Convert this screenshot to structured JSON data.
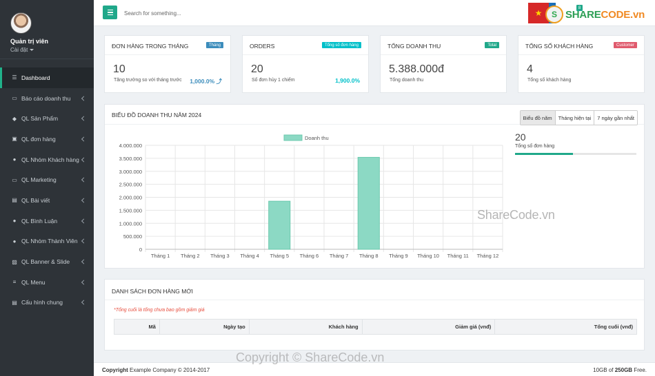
{
  "colors": {
    "sidebar_bg": "#2e3338",
    "accent": "#20a88a",
    "bar_fill": "#8cd9c4",
    "badge_blue": "#3c8dbc",
    "badge_teal": "#00c0c9",
    "badge_green": "#20a88a",
    "badge_red": "#e05a6d",
    "note_red": "#e74c3c"
  },
  "profile": {
    "name": "Quản trị viên",
    "sub": "Cài đặt"
  },
  "sidebar": {
    "items": [
      {
        "label": "Dashboard",
        "icon": "database-icon",
        "active": true
      },
      {
        "label": "Báo cáo doanh thu",
        "icon": "money-icon"
      },
      {
        "label": "QL Sản Phẩm",
        "icon": "cube-icon"
      },
      {
        "label": "QL đơn hàng",
        "icon": "bag-icon"
      },
      {
        "label": "QL Nhóm Khách hàng",
        "icon": "user-icon"
      },
      {
        "label": "QL Marketing",
        "icon": "money-icon"
      },
      {
        "label": "QL Bài viết",
        "icon": "file-icon"
      },
      {
        "label": "QL Bình Luận",
        "icon": "comment-icon"
      },
      {
        "label": "QL Nhóm Thành Viên",
        "icon": "user-icon"
      },
      {
        "label": "QL Banner & Slide",
        "icon": "image-icon"
      },
      {
        "label": "QL Menu",
        "icon": "list-icon"
      },
      {
        "label": "Cấu hình chung",
        "icon": "file-icon"
      }
    ]
  },
  "topbar": {
    "search_placeholder": "Search for something...",
    "notif_count": "8",
    "brand_a": "SHARE",
    "brand_b": "CODE.vn"
  },
  "stats": [
    {
      "title": "ĐƠN HÀNG TRONG THÁNG",
      "badge": "Tháng",
      "value": "10",
      "desc": "Tăng trưởng so với tháng trước",
      "extra": "1,000.0% ⤴"
    },
    {
      "title": "ORDERS",
      "badge": "Tổng số đơn hàng",
      "value": "20",
      "desc": "Số đơn hủy 1 chiếm",
      "extra": "1,900.0%"
    },
    {
      "title": "TỔNG DOANH THU",
      "badge": "Total",
      "value": "5.388.000đ",
      "desc": "Tổng doanh thu",
      "extra": ""
    },
    {
      "title": "TỔNG SỐ KHÁCH HÀNG",
      "badge": "Customer",
      "value": "4",
      "desc": "Tổng số khách hàng",
      "extra": ""
    }
  ],
  "chart_section": {
    "title": "BIỂU ĐỒ DOANH THU NĂM 2024",
    "tabs": [
      "Biểu đồ năm",
      "Tháng hiện tại",
      "7 ngày gần nhất"
    ],
    "side_value": "20",
    "side_label": "Tổng số đơn hàng",
    "side_progress": 0.48
  },
  "chart_data": {
    "type": "bar",
    "legend": "Doanh thu",
    "categories": [
      "Tháng 1",
      "Tháng 2",
      "Tháng 3",
      "Tháng 4",
      "Tháng 5",
      "Tháng 6",
      "Tháng 7",
      "Tháng 8",
      "Tháng 9",
      "Tháng 10",
      "Tháng 11",
      "Tháng 12"
    ],
    "values": [
      0,
      0,
      0,
      0,
      1850000,
      0,
      0,
      3538000,
      0,
      0,
      0,
      0
    ],
    "yticks": [
      "4.000.000",
      "3.500.000",
      "3.000.000",
      "2.500.000",
      "2.000.000",
      "1.500.000",
      "1.000.000",
      "500.000",
      "0"
    ],
    "ylim": [
      0,
      4000000
    ],
    "grid": true,
    "legend_position": "top"
  },
  "orders": {
    "title": "DANH SÁCH ĐƠN HÀNG MỚI",
    "note": "*Tổng cuối là tổng chưa bao gồm giảm giá",
    "columns": [
      "Mã",
      "Ngày tạo",
      "Khách hàng",
      "Giảm giá (vnđ)",
      "Tổng cuối (vnđ)"
    ]
  },
  "footer": {
    "copyright_bold": "Copyright",
    "copyright_rest": " Example Company © 2014-2017",
    "storage_pre": "10GB of ",
    "storage_bold": "250GB",
    "storage_post": " Free."
  },
  "watermarks": {
    "mid": "ShareCode.vn",
    "bottom": "Copyright © ShareCode.vn"
  }
}
